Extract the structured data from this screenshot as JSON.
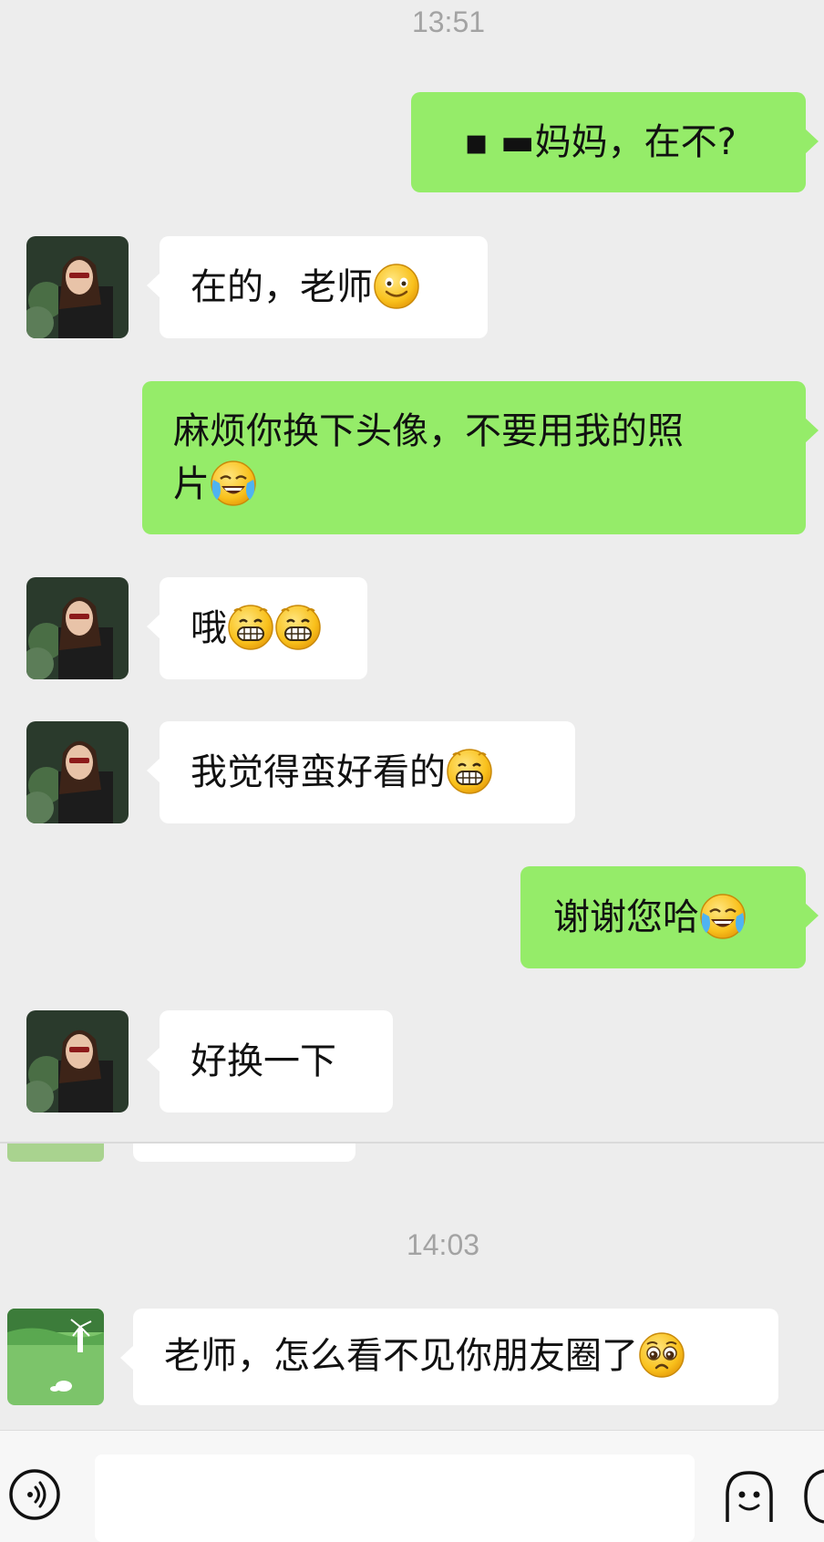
{
  "timestamps": {
    "first": "13:51",
    "second": "14:03"
  },
  "messages": [
    {
      "side": "out",
      "text": "▪ ▬妈妈，在不?"
    },
    {
      "side": "in",
      "text": "在的，老师"
    },
    {
      "side": "out",
      "line1": "麻烦你换下头像，不要用我的照",
      "line2": "片"
    },
    {
      "side": "in",
      "text": "哦"
    },
    {
      "side": "in",
      "text": "我觉得蛮好看的"
    },
    {
      "side": "out",
      "text": "谢谢您哈"
    },
    {
      "side": "in",
      "text": "好换一下"
    },
    {
      "side": "in",
      "text": "老师，怎么看不见你朋友圈了"
    }
  ],
  "colors": {
    "background": "#ededed",
    "outgoing_bubble": "#95ec69",
    "incoming_bubble": "#ffffff",
    "timestamp": "#a3a3a3"
  },
  "icons": [
    "voice-icon",
    "emoji-face-icon",
    "smile-emoji",
    "tears-of-joy-emoji",
    "grin-emoji",
    "pleading-emoji"
  ]
}
